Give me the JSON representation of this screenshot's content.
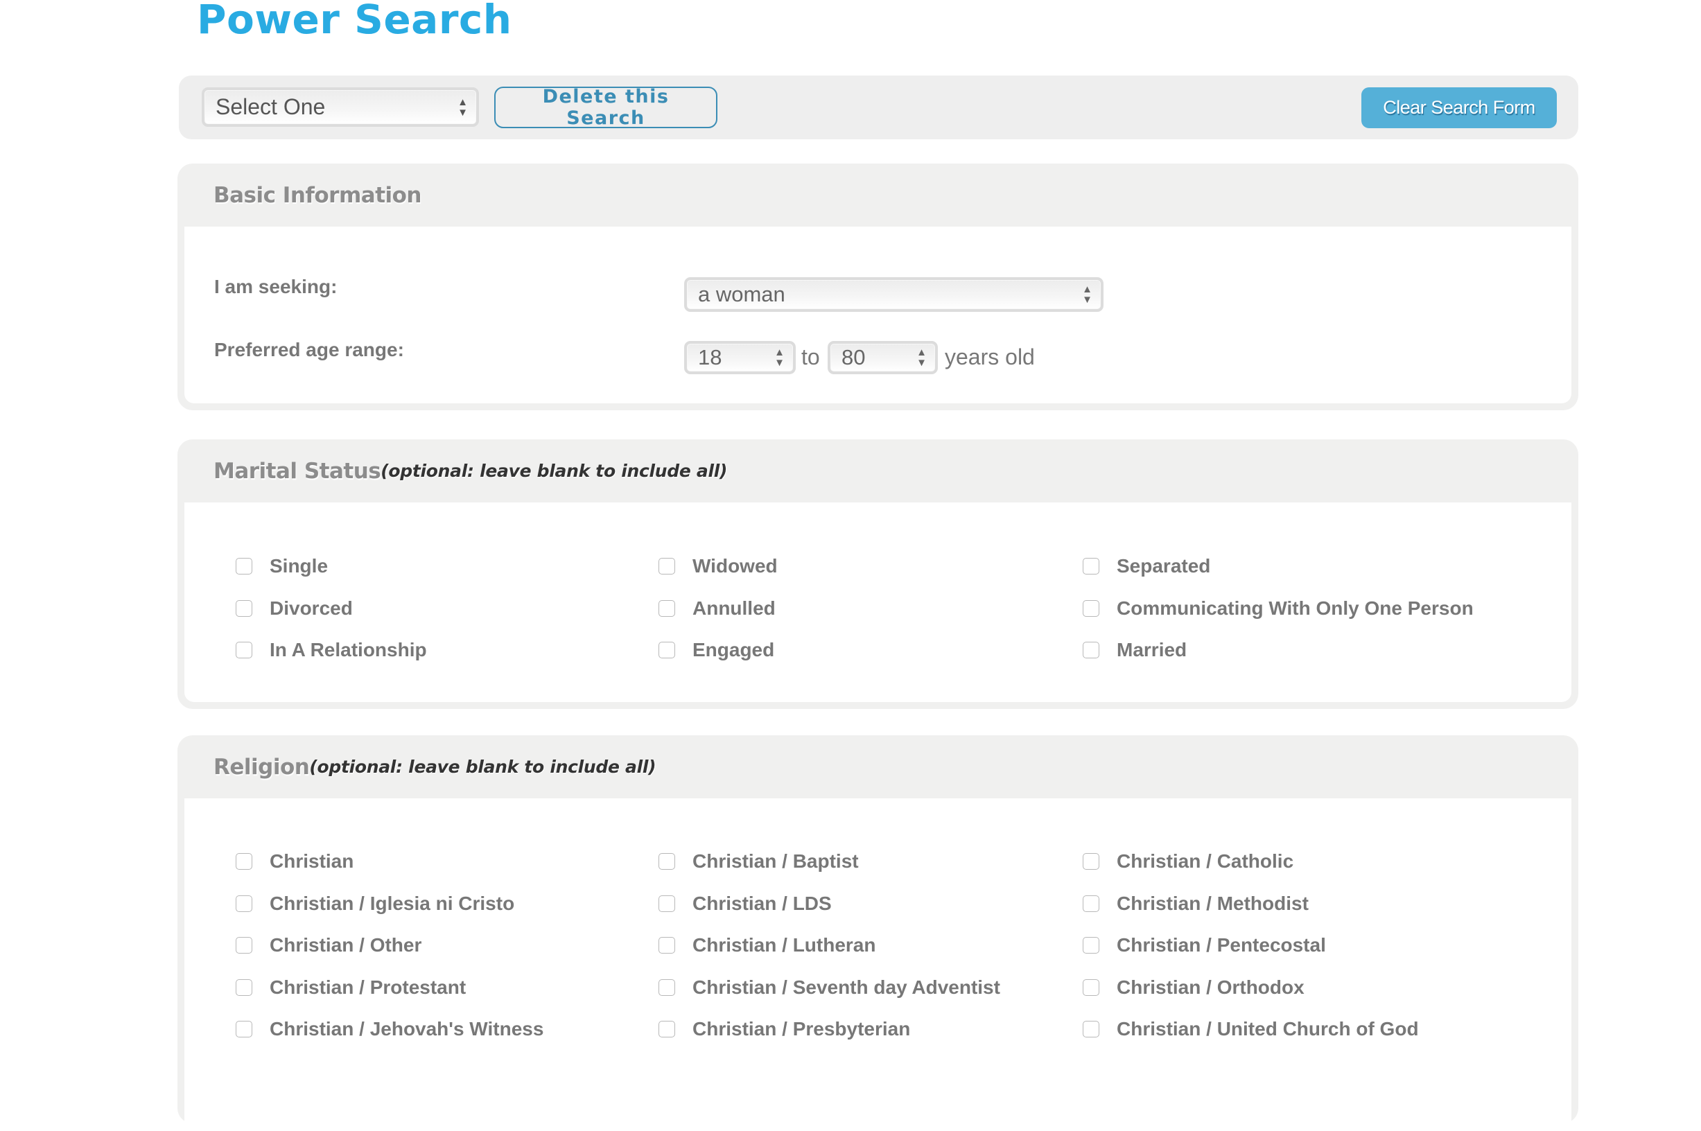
{
  "page": {
    "title": "Power Search"
  },
  "toolbar": {
    "saved_search_select": {
      "value": "Select One"
    },
    "delete_label": "Delete this Search",
    "clear_label": "Clear Search Form"
  },
  "basic_info": {
    "title": "Basic Information",
    "seeking_label": "I am seeking:",
    "seeking_value": "a woman",
    "age_label": "Preferred age range:",
    "age_min": "18",
    "age_to": "to",
    "age_max": "80",
    "age_suffix": "years old"
  },
  "marital_status": {
    "title": "Marital Status",
    "note": "(optional: leave blank to include all)",
    "options": [
      {
        "label": "Single",
        "checked": false
      },
      {
        "label": "Widowed",
        "checked": false
      },
      {
        "label": "Separated",
        "checked": false
      },
      {
        "label": "Divorced",
        "checked": false
      },
      {
        "label": "Annulled",
        "checked": false
      },
      {
        "label": "Communicating With Only One Person",
        "checked": false
      },
      {
        "label": "In A Relationship",
        "checked": false
      },
      {
        "label": "Engaged",
        "checked": false
      },
      {
        "label": "Married",
        "checked": false
      }
    ]
  },
  "religion": {
    "title": "Religion",
    "note": "(optional: leave blank to include all)",
    "options": [
      {
        "label": "Christian",
        "checked": false
      },
      {
        "label": "Christian / Baptist",
        "checked": false
      },
      {
        "label": "Christian / Catholic",
        "checked": false
      },
      {
        "label": "Christian / Iglesia ni Cristo",
        "checked": false
      },
      {
        "label": "Christian / LDS",
        "checked": false
      },
      {
        "label": "Christian / Methodist",
        "checked": false
      },
      {
        "label": "Christian / Other",
        "checked": false
      },
      {
        "label": "Christian / Lutheran",
        "checked": false
      },
      {
        "label": "Christian / Pentecostal",
        "checked": false
      },
      {
        "label": "Christian / Protestant",
        "checked": false
      },
      {
        "label": "Christian / Seventh day Adventist",
        "checked": false
      },
      {
        "label": "Christian / Orthodox",
        "checked": false
      },
      {
        "label": "Christian / Jehovah's Witness",
        "checked": false
      },
      {
        "label": "Christian / Presbyterian",
        "checked": false
      },
      {
        "label": "Christian / United Church of God",
        "checked": false
      }
    ]
  },
  "colors": {
    "title_blue": "#29abe2",
    "delete_blue": "#3b8db5",
    "clear_button_bg": "#55b0d8",
    "panel_bg": "#f0f0ef",
    "label_gray": "#777777"
  }
}
